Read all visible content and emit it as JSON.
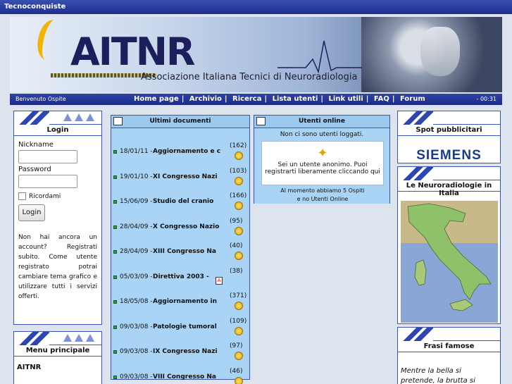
{
  "topbar": {
    "title": "Tecnoconquiste"
  },
  "banner": {
    "logo_text": "AITNR",
    "subtitle": "Associazione Italiana Tecnici di Neuroradiologia"
  },
  "navbar": {
    "welcome": "Benvenuto Ospite",
    "links": [
      "Home page",
      "Archivio",
      "Ricerca",
      "Lista utenti",
      "Link utili",
      "FAQ",
      "Forum"
    ],
    "time": "- 00:31"
  },
  "login": {
    "title": "Login",
    "nickname_label": "Nickname",
    "password_label": "Password",
    "remember_label": "Ricordami",
    "button_label": "Login",
    "info_text": "Non hai ancora un account? Registrati subito. Come utente registrato potrai cambiare tema grafico e utilizzare tutti i servizi offerti."
  },
  "menu": {
    "title": "Menu principale",
    "items": [
      "AITNR"
    ]
  },
  "docs": {
    "title": "Ultimi documenti",
    "items": [
      {
        "date": "18/01/11 -",
        "title": "Aggiornamento e c",
        "count": "(162)",
        "icon": "download-icon"
      },
      {
        "date": "19/01/10 -",
        "title": "XI Congresso Nazi",
        "count": "(103)",
        "icon": "download-icon"
      },
      {
        "date": "15/06/09 -",
        "title": "Studio del cranio",
        "count": "(166)",
        "icon": "download-icon"
      },
      {
        "date": "28/04/09 -",
        "title": "X Congresso Nazio",
        "count": "(95)",
        "icon": "download-icon"
      },
      {
        "date": "28/04/09 -",
        "title": "XIII Congresso Na",
        "count": "(40)",
        "icon": "download-icon"
      },
      {
        "date": "05/03/09 -",
        "title": "Direttiva 2003 -",
        "count": "(38)",
        "icon": "pdf-icon"
      },
      {
        "date": "18/05/08 -",
        "title": "Aggiornamento in",
        "count": "(371)",
        "icon": "download-icon"
      },
      {
        "date": "09/03/08 -",
        "title": "Patologie tumoral",
        "count": "(109)",
        "icon": "download-icon"
      },
      {
        "date": "09/03/08 -",
        "title": "IX Congresso Nazi",
        "count": "(97)",
        "icon": "download-icon"
      },
      {
        "date": "09/03/08 -",
        "title": "VIII Congresso Na",
        "count": "(46)",
        "icon": "download-icon"
      }
    ]
  },
  "online": {
    "title": "Utenti online",
    "none_text": "Non ci sono utenti loggati.",
    "anon_text": "Sei un utente anonimo. Puoi registrarti liberamente cliccando qui",
    "stats_line1": "Al momento abbiamo 5 Ospiti",
    "stats_line2": "e no Utenti Online"
  },
  "spot": {
    "title": "Spot pubblicitari",
    "sponsor": "SIEMENS"
  },
  "map": {
    "title": "Le Neuroradiologie in Italia"
  },
  "frasi": {
    "title": "Frasi famose",
    "quote": "Mentre la bella si pretende, la brutta si marita ."
  },
  "colors": {
    "nav": "#1e2f8e",
    "panel": "#a9d4f5",
    "border": "#3b54b6",
    "siemens": "#1a3d8a"
  }
}
